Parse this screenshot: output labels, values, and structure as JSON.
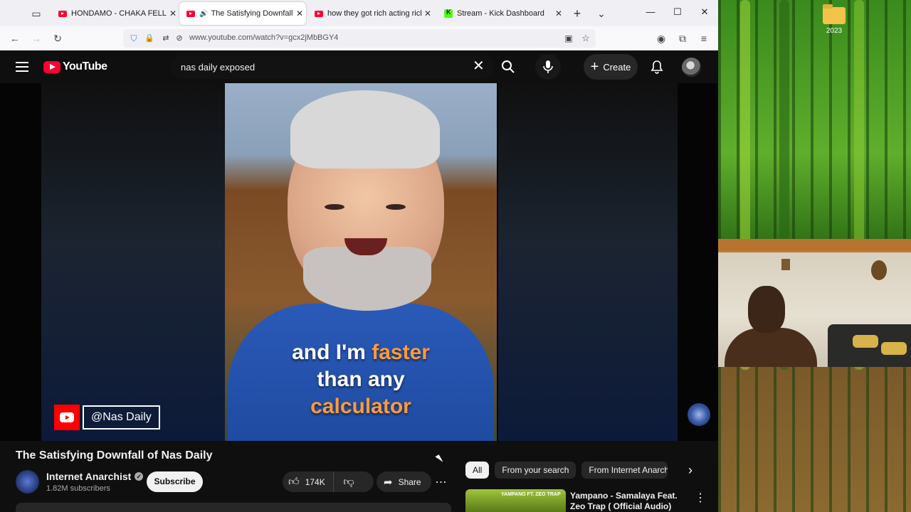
{
  "browser": {
    "tabs": [
      {
        "title": "HONDAMO - CHAKA FELLA F",
        "favicon": "youtube-icon"
      },
      {
        "title": "The Satisfying Downfall of",
        "favicon": "youtube-icon",
        "active": true,
        "playing": true
      },
      {
        "title": "how they got rich acting rich",
        "favicon": "youtube-icon"
      },
      {
        "title": "Stream - Kick Dashboard",
        "favicon": "kick-icon"
      }
    ],
    "url": "www.youtube.com/watch?v=gcx2jMbBGY4"
  },
  "youtube": {
    "logo_text": "YouTube",
    "search_query": "nas daily exposed",
    "create_label": "Create",
    "video": {
      "caption_line1": "and I'm ",
      "caption_highlight1": "faster",
      "caption_line2": "than any",
      "caption_highlight2": "calculator",
      "watermark_handle": "@Nas Daily"
    },
    "title": "The Satisfying Downfall of Nas Daily",
    "channel": {
      "name": "Internet Anarchist",
      "subscribers": "1.82M subscribers",
      "verified": true
    },
    "subscribe_label": "Subscribe",
    "likes": "174K",
    "share_label": "Share",
    "chips": [
      "All",
      "From your search",
      "From Internet Anarchist"
    ],
    "recommended": {
      "title": "Yampano - Samalaya Feat. Zeo Trap ( Official Audio)",
      "thumb_text": "YAMPANO FT. ZEO TRAP"
    }
  },
  "desktop": {
    "icon_label": "2023"
  },
  "colors": {
    "youtube_red": "#ff0033",
    "dark_bg": "#0f0f0f",
    "pill_bg": "#272727"
  }
}
